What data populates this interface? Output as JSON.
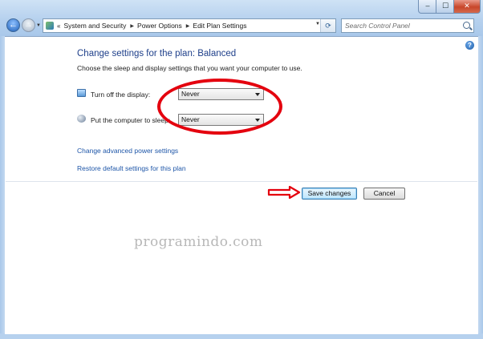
{
  "window": {
    "minimize_glyph": "–",
    "maximize_glyph": "☐",
    "close_glyph": "✕"
  },
  "navigation": {
    "back_glyph": "←",
    "forward_glyph": "→",
    "history_glyph": "▼"
  },
  "address_bar": {
    "more_glyph": "«",
    "separator_glyph": "▶",
    "dropdown_glyph": "▼",
    "refresh_glyph": "⟳",
    "breadcrumbs": [
      "System and Security",
      "Power Options",
      "Edit Plan Settings"
    ]
  },
  "search": {
    "placeholder": "Search Control Panel"
  },
  "help": {
    "glyph": "?"
  },
  "main": {
    "title": "Change settings for the plan: Balanced",
    "instruction": "Choose the sleep and display settings that you want your computer to use.",
    "settings": [
      {
        "label": "Turn off the display:",
        "value": "Never",
        "icon": "display-monitor-icon"
      },
      {
        "label": "Put the computer to sleep:",
        "value": "Never",
        "icon": "sleep-moon-icon"
      }
    ],
    "links": [
      "Change advanced power settings",
      "Restore default settings for this plan"
    ],
    "buttons": {
      "save": "Save changes",
      "cancel": "Cancel"
    }
  },
  "watermark": "programindo.com",
  "colors": {
    "title": "#1e3f8a",
    "link": "#1e56a8",
    "annotation": "#e4000e"
  }
}
